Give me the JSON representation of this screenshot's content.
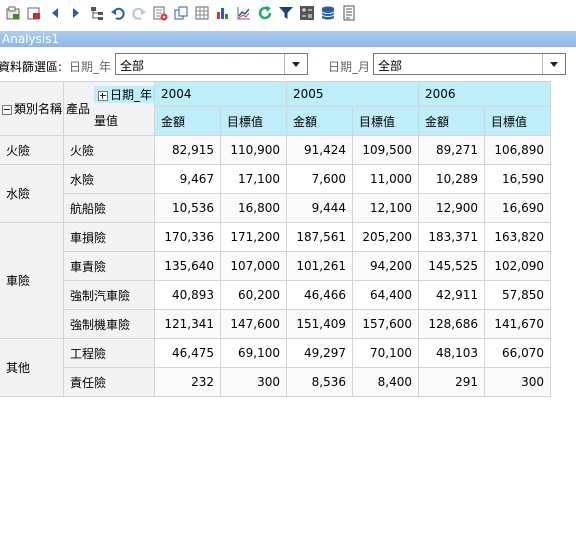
{
  "window_title": "Analysis1",
  "toolbar": {
    "icons": [
      "save-icon",
      "export-icon",
      "back-icon",
      "forward-icon",
      "tree-icon",
      "undo-icon",
      "redo-icon",
      "add-chart-icon",
      "copy-icon",
      "table-icon",
      "bar-chart-icon",
      "line-chart-icon",
      "refresh-icon",
      "filter-icon",
      "calculator-icon",
      "database-icon",
      "document-icon"
    ]
  },
  "filter": {
    "label": "資料篩選區:",
    "year_label": "日期_年",
    "year_value": "全部",
    "month_label": "日期_月",
    "month_value": "全部"
  },
  "pivot": {
    "row_headers": {
      "category": "類別名稱",
      "product": "產品"
    },
    "column_field": "日期_年",
    "measure_label": "量值",
    "years": [
      "2004",
      "2005",
      "2006"
    ],
    "measures": [
      "金額",
      "目標值"
    ],
    "categories": [
      {
        "name": "火險",
        "products": [
          {
            "name": "火險",
            "values": [
              "82,915",
              "110,900",
              "91,424",
              "109,500",
              "89,271",
              "106,890"
            ]
          }
        ]
      },
      {
        "name": "水險",
        "products": [
          {
            "name": "水險",
            "values": [
              "9,467",
              "17,100",
              "7,600",
              "11,000",
              "10,289",
              "16,590"
            ]
          },
          {
            "name": "航船險",
            "values": [
              "10,536",
              "16,800",
              "9,444",
              "12,100",
              "12,900",
              "16,690"
            ]
          }
        ]
      },
      {
        "name": "車險",
        "products": [
          {
            "name": "車損險",
            "values": [
              "170,336",
              "171,200",
              "187,561",
              "205,200",
              "183,371",
              "163,820"
            ]
          },
          {
            "name": "車責險",
            "values": [
              "135,640",
              "107,000",
              "101,261",
              "94,200",
              "145,525",
              "102,090"
            ]
          },
          {
            "name": "強制汽車險",
            "values": [
              "40,893",
              "60,200",
              "46,466",
              "64,400",
              "42,911",
              "57,850"
            ]
          },
          {
            "name": "強制機車險",
            "values": [
              "121,341",
              "147,600",
              "151,409",
              "157,600",
              "128,686",
              "141,670"
            ]
          }
        ]
      },
      {
        "name": "其他",
        "products": [
          {
            "name": "工程險",
            "values": [
              "46,475",
              "69,100",
              "49,297",
              "70,100",
              "48,103",
              "66,070"
            ]
          },
          {
            "name": "責任險",
            "values": [
              "232",
              "300",
              "8,536",
              "8,400",
              "291",
              "300"
            ]
          }
        ]
      }
    ]
  }
}
